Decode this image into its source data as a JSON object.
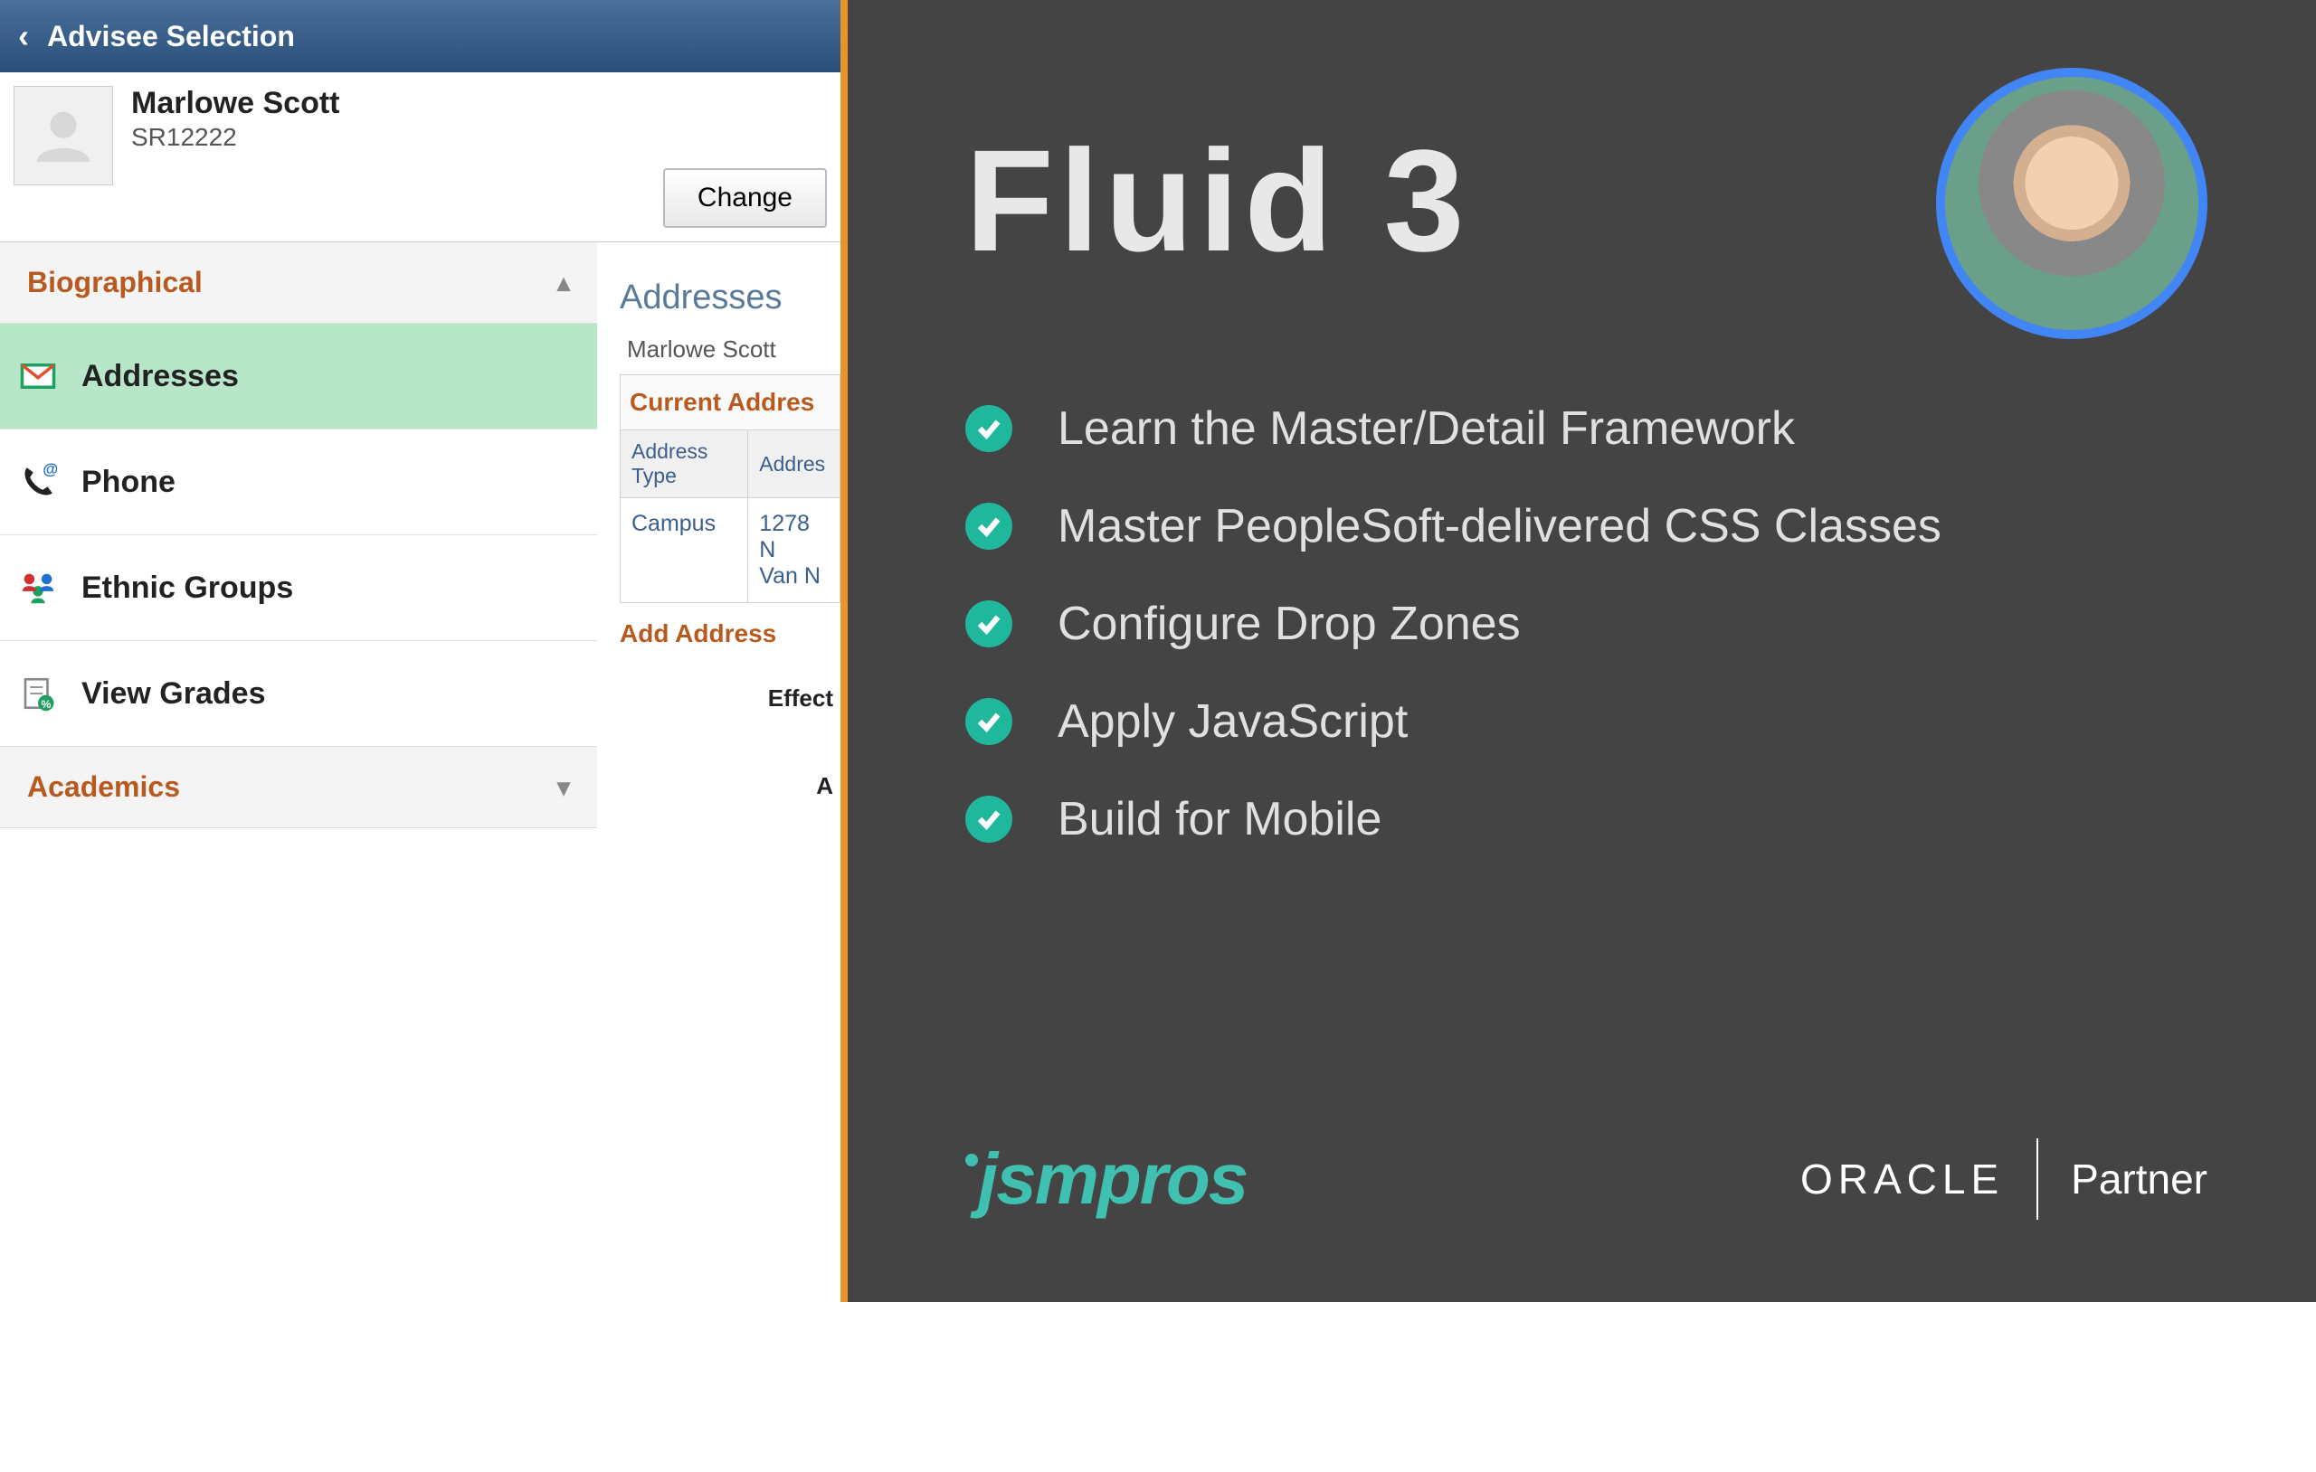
{
  "header": {
    "title": "Advisee Selection"
  },
  "student": {
    "name": "Marlowe Scott",
    "id": "SR12222",
    "change_label": "Change"
  },
  "categories": {
    "bio": {
      "label": "Biographical",
      "expanded": true
    },
    "academics": {
      "label": "Academics",
      "expanded": false
    }
  },
  "nav": {
    "addresses": "Addresses",
    "phone": "Phone",
    "ethnic": "Ethnic Groups",
    "grades": "View Grades"
  },
  "detail": {
    "heading": "Addresses",
    "student_name": "Marlowe Scott",
    "section": "Current Addres",
    "th_type": "Address Type",
    "th_address": "Addres",
    "row_type": "Campus",
    "row_line1": "1278 N",
    "row_line2": "Van N",
    "add_link": "Add Address",
    "effect": "Effect",
    "a_label": "A"
  },
  "slide": {
    "title": "Fluid 3",
    "bullets": [
      "Learn the Master/Detail Framework",
      "Master PeopleSoft-delivered CSS Classes",
      "Configure Drop Zones",
      "Apply JavaScript",
      "Build for Mobile"
    ],
    "logo1": "jsmpros",
    "oracle": "ORACLE",
    "partner": "Partner"
  }
}
